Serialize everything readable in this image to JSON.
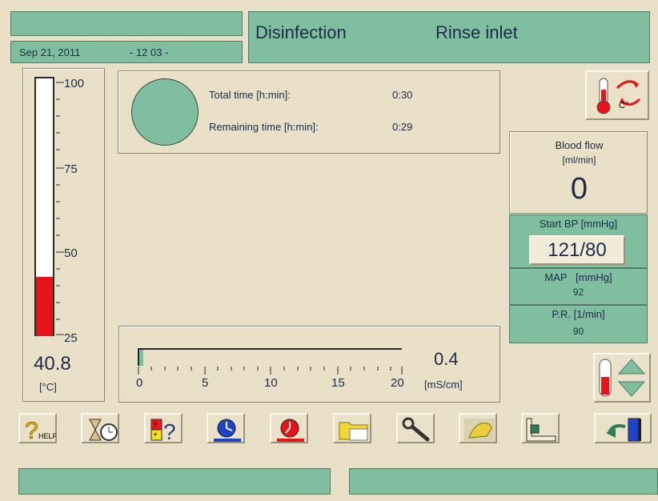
{
  "header": {
    "date": "Sep 21, 2011",
    "time": "- 12 03 -",
    "mode": "Disinfection",
    "step": "Rinse inlet"
  },
  "thermometer": {
    "scale": [
      "100",
      "75",
      "50",
      "25"
    ],
    "value": "40.8",
    "unit": "[°C]",
    "fill_fraction": 0.23
  },
  "timer": {
    "total_label": "Total time [h:min]:",
    "total_value": "0:30",
    "remaining_label": "Remaining time [h:min]:",
    "remaining_value": "0:29"
  },
  "conductivity": {
    "ticks": [
      "0",
      "5",
      "10",
      "15",
      "20"
    ],
    "value": "0.4",
    "unit": "[mS/cm]"
  },
  "blood": {
    "flow_label": "Blood flow",
    "flow_unit": "[ml/min]",
    "flow_value": "0",
    "bp_label": "Start BP [mmHg]",
    "bp_value": "121/80",
    "map_label": "MAP   [mmHg]",
    "map_value": "92",
    "pr_label": "P.R. [1/min]",
    "pr_value": "90"
  },
  "toolbar": {
    "help_text": "HELP"
  },
  "colors": {
    "background": "#e8e1c8",
    "accent_green": "#7fbfa0",
    "thermo_red": "#e8141a"
  }
}
